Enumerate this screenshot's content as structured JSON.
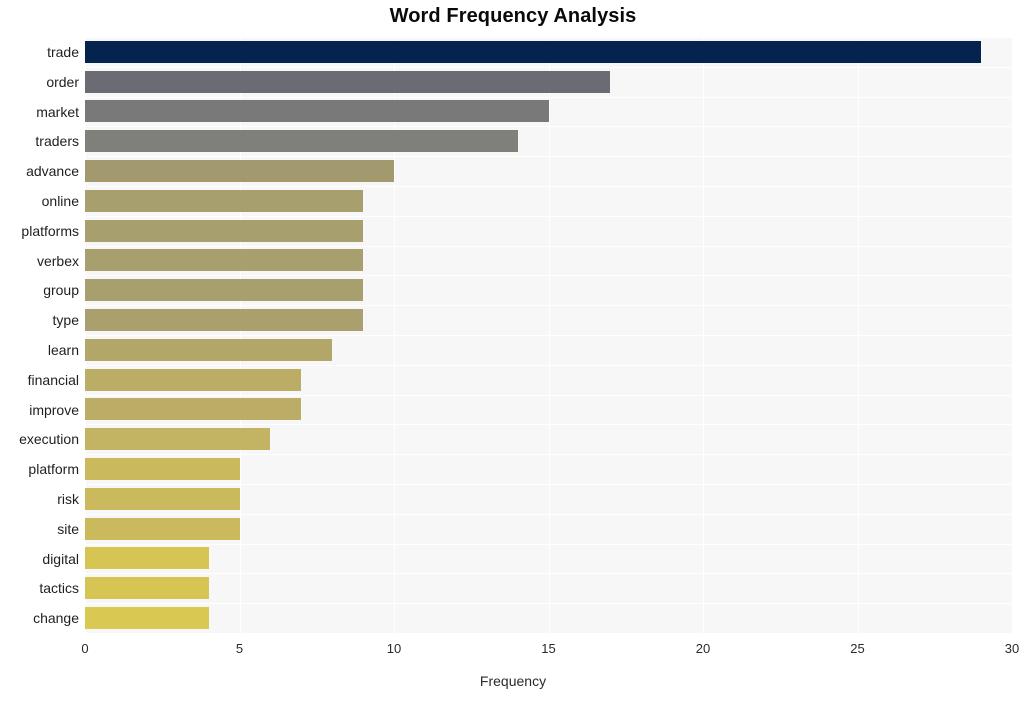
{
  "chart_data": {
    "type": "bar",
    "orientation": "horizontal",
    "title": "Word Frequency Analysis",
    "xlabel": "Frequency",
    "ylabel": "",
    "xlim": [
      0,
      30
    ],
    "xticks": [
      0,
      5,
      10,
      15,
      20,
      25,
      30
    ],
    "grid": true,
    "legend": "none",
    "categories": [
      "trade",
      "order",
      "market",
      "traders",
      "advance",
      "online",
      "platforms",
      "verbex",
      "group",
      "type",
      "learn",
      "financial",
      "improve",
      "execution",
      "platform",
      "risk",
      "site",
      "digital",
      "tactics",
      "change"
    ],
    "values": [
      29,
      17,
      15,
      14,
      10,
      9,
      9,
      9,
      9,
      9,
      8,
      7,
      7,
      6,
      5,
      5,
      5,
      4,
      4,
      4
    ],
    "bar_colors": [
      "#04244f",
      "#6b6b73",
      "#79797a",
      "#80807a",
      "#a2996f",
      "#a89f6e",
      "#a89f6e",
      "#a89f6e",
      "#a89f6e",
      "#aaa06d",
      "#b2a669",
      "#bbad66",
      "#bbad66",
      "#c3b463",
      "#cbba5d",
      "#cbba5d",
      "#cbba5d",
      "#d6c453",
      "#d6c453",
      "#d9c851"
    ],
    "plot_background": "#f7f7f7",
    "gridline_color": "#ffffff",
    "figure_background": "#ffffff"
  }
}
